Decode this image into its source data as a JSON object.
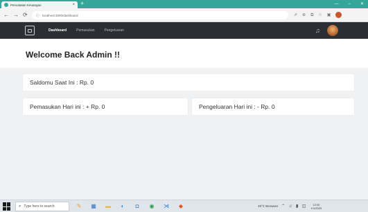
{
  "browser": {
    "tab_title": "Pencatatan Keuangan",
    "tab_close": "×",
    "new_tab": "+",
    "url": "localhost:3000/dashboard",
    "win_minimize": "—",
    "win_restore": "–",
    "win_close": "✕"
  },
  "app": {
    "nav": {
      "items": [
        {
          "label": "Dashboard",
          "active": true
        },
        {
          "label": "Pemasukan",
          "active": false
        },
        {
          "label": "Pengeluaran",
          "active": false
        }
      ]
    },
    "welcome": "Welcome Back Admin !!",
    "cards": {
      "saldo": "Saldomu Saat Ini : Rp. 0",
      "pemasukan": "Pemasukan Hari ini : + Rp. 0",
      "pengeluaran": "Pengeluaran Hari ini : - Rp. 0"
    }
  },
  "taskbar": {
    "search_placeholder": "Type here to search",
    "weather": "29°C Berawan",
    "time": "12:00",
    "date": "1/1/2023"
  },
  "colors": {
    "tabstrip": "#35a79a",
    "navbar": "#2b2f33",
    "page_bg": "#f0f1f3"
  }
}
